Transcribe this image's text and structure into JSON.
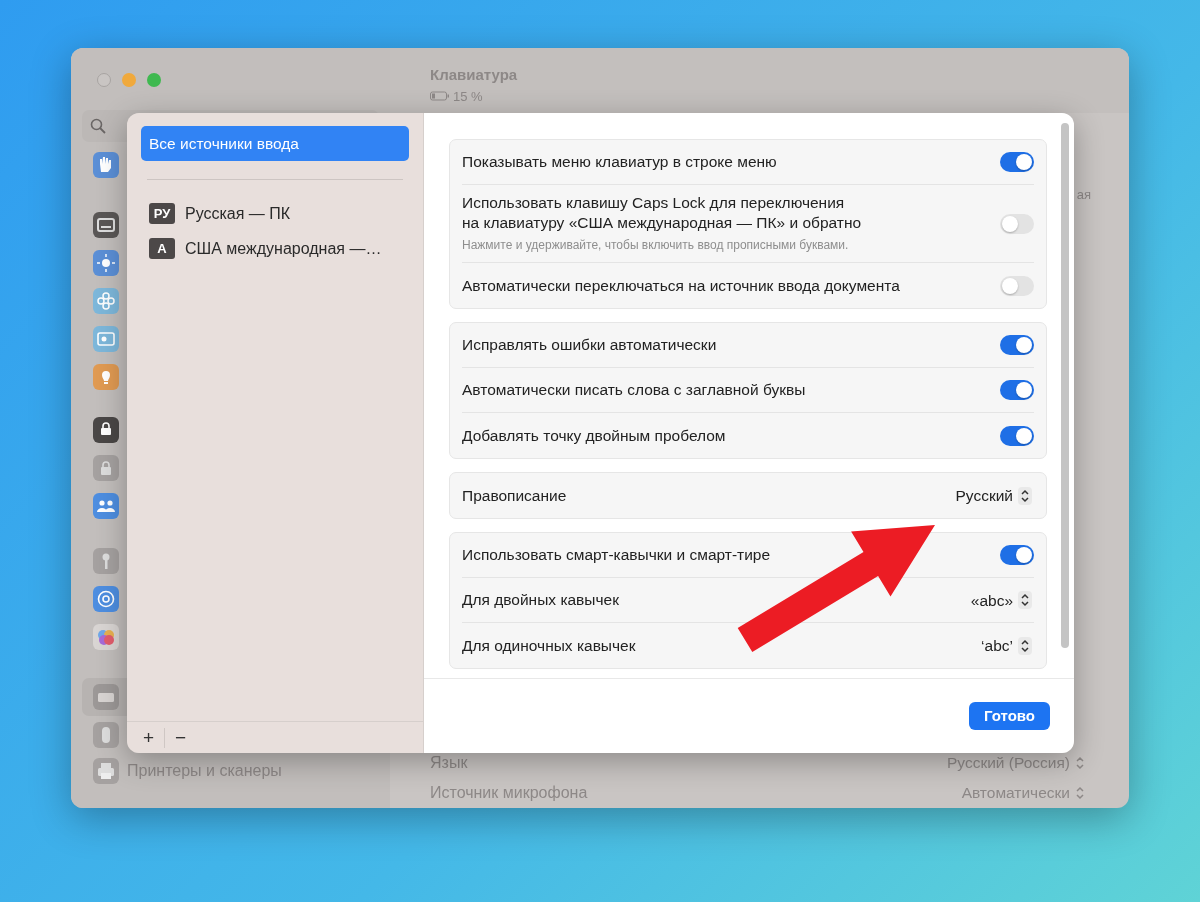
{
  "background_window": {
    "title": "Клавиатура",
    "battery": "15 %",
    "fragment": "ая",
    "sidebar": {
      "items": [
        {
          "label": "Принтеры и сканеры"
        }
      ]
    },
    "rows": [
      {
        "label": "Язык",
        "value": "Русский (Россия)"
      },
      {
        "label": "Источник микрофона",
        "value": "Автоматически"
      }
    ]
  },
  "sheet": {
    "sources": [
      {
        "kind": "all",
        "label": "Все источники ввода",
        "selected": true
      },
      {
        "kind": "layout",
        "badge": "РУ",
        "label": "Русская — ПК",
        "selected": false
      },
      {
        "kind": "layout",
        "badge": "A",
        "label": "США международная —…",
        "selected": false
      }
    ],
    "list_buttons": [
      "+",
      "−"
    ],
    "groups": [
      {
        "rows": [
          {
            "kind": "toggle",
            "label": "Показывать меню клавиатур в строке меню",
            "on": true
          },
          {
            "kind": "toggle",
            "label": "Использовать клавишу Caps Lock для переключения\nна клавиатуру «США международная — ПК» и обратно",
            "hint": "Нажмите и удерживайте, чтобы включить ввод прописными буквами.",
            "on": false
          },
          {
            "kind": "toggle",
            "label": "Автоматически переключаться на источник ввода документа",
            "on": false
          }
        ]
      },
      {
        "rows": [
          {
            "kind": "toggle",
            "label": "Исправлять ошибки автоматически",
            "on": true
          },
          {
            "kind": "toggle",
            "label": "Автоматически писать слова с заглавной буквы",
            "on": true
          },
          {
            "kind": "toggle",
            "label": "Добавлять точку двойным пробелом",
            "on": true
          }
        ]
      },
      {
        "rows": [
          {
            "kind": "popup",
            "label": "Правописание",
            "value": "Русский"
          }
        ]
      },
      {
        "rows": [
          {
            "kind": "toggle",
            "label": "Использовать смарт-кавычки и смарт-тире",
            "on": true
          },
          {
            "kind": "popup",
            "label": "Для двойных кавычек",
            "value": "«abc»"
          },
          {
            "kind": "popup",
            "label": "Для одиночных кавычек",
            "value": "‘abc’"
          }
        ]
      }
    ],
    "done_button": "Готово"
  }
}
